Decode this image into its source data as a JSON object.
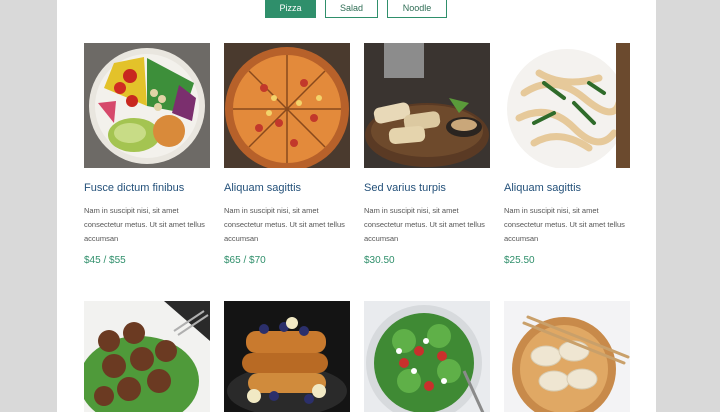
{
  "filters": [
    {
      "label": "Pizza",
      "active": true
    },
    {
      "label": "Salad",
      "active": false
    },
    {
      "label": "Noodle",
      "active": false
    }
  ],
  "items": [
    {
      "title": "Fusce dictum finibus",
      "description": "Nam in suscipit nisi, sit amet consectetur metus. Ut sit amet tellus accumsan",
      "price": "$45 / $55",
      "image": "salad-bowl"
    },
    {
      "title": "Aliquam sagittis",
      "description": "Nam in suscipit nisi, sit amet consectetur metus. Ut sit amet tellus accumsan",
      "price": "$65 / $70",
      "image": "pizza"
    },
    {
      "title": "Sed varius turpis",
      "description": "Nam in suscipit nisi, sit amet consectetur metus. Ut sit amet tellus accumsan",
      "price": "$30.50",
      "image": "grilled-chicken"
    },
    {
      "title": "Aliquam sagittis",
      "description": "Nam in suscipit nisi, sit amet consectetur metus. Ut sit amet tellus accumsan",
      "price": "$25.50",
      "image": "noodles"
    },
    {
      "image": "meatballs"
    },
    {
      "image": "french-toast"
    },
    {
      "image": "green-salad"
    },
    {
      "image": "dumplings"
    }
  ],
  "colors": {
    "accent": "#2f8f6b",
    "title": "#24517a",
    "background": "#d9d9d9"
  }
}
